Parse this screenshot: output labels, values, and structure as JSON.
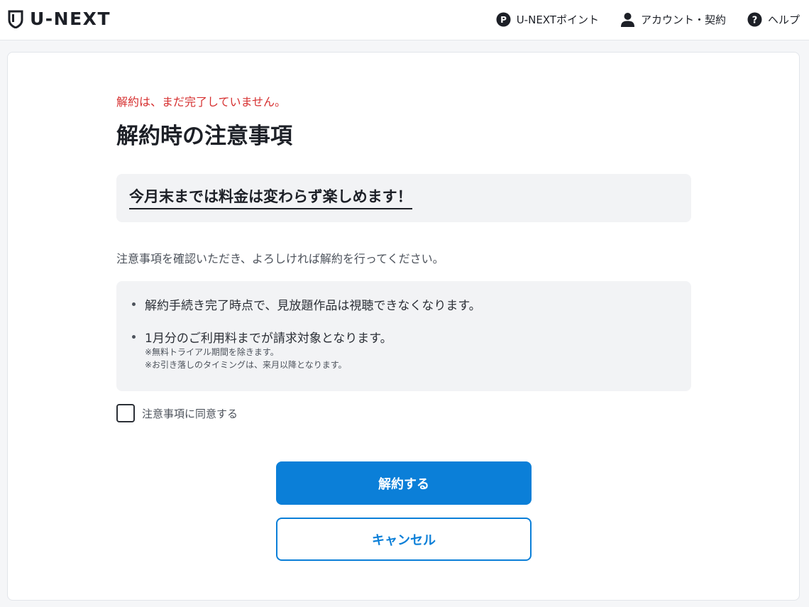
{
  "header": {
    "logo_text": "U-NEXT",
    "nav": {
      "points": "U-NEXTポイント",
      "account": "アカウント・契約",
      "help": "ヘルプ"
    }
  },
  "main": {
    "notice": "解約は、まだ完了していません。",
    "title": "解約時の注意事項",
    "highlight": "今月末までは料金は変わらず楽しめます！",
    "intro": "注意事項を確認いただき、よろしければ解約を行ってください。",
    "items": [
      {
        "text": "解約手続き完了時点で、見放題作品は視聴できなくなります。"
      },
      {
        "text": "1月分のご利用料までが請求対象となります。",
        "notes": [
          "※無料トライアル期間を除きます。",
          "※お引き落しのタイミングは、来月以降となります。"
        ]
      }
    ],
    "agree_label": "注意事項に同意する",
    "agree_checked": false,
    "cancel_contract_button": "解約する",
    "back_button": "キャンセル"
  },
  "colors": {
    "accent": "#0b7fd8",
    "warning": "#d63030",
    "panel": "#f2f3f5"
  },
  "icons": {
    "logo": "shield-logo-icon",
    "points": "point-coin-icon",
    "account": "person-icon",
    "help": "help-circle-icon"
  }
}
